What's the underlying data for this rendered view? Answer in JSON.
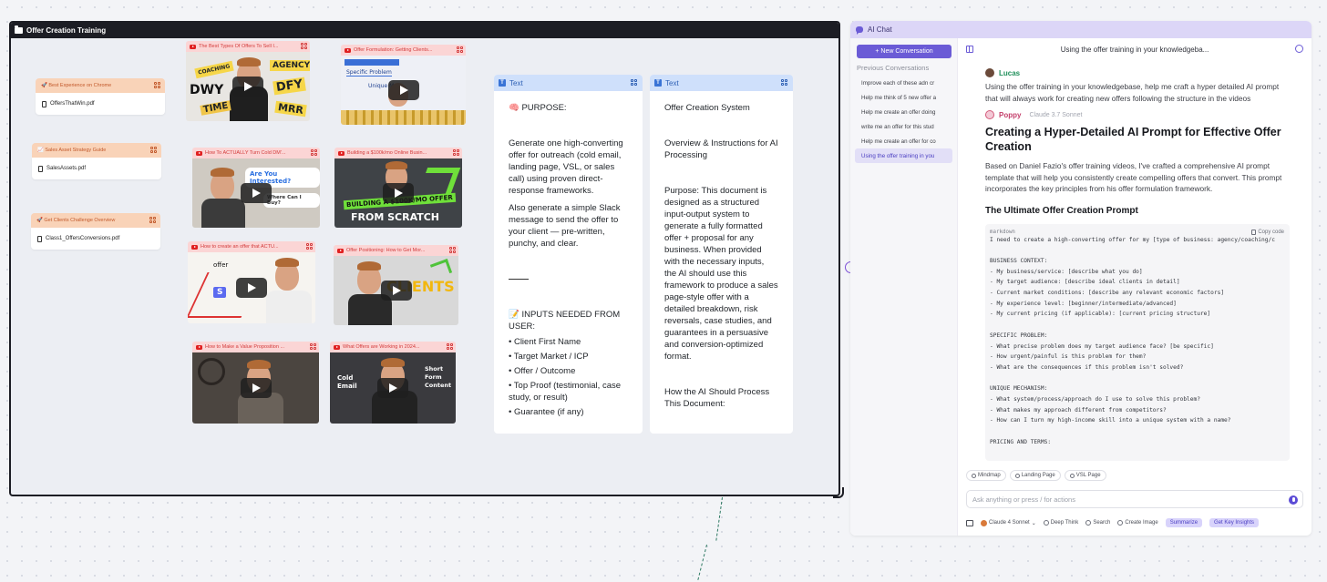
{
  "board": {
    "title": "Offer Creation Training"
  },
  "pdfs": [
    {
      "title": "🚀 Best Experience on Chrome",
      "file": "OffersThatWin.pdf"
    },
    {
      "title": "📈 Sales Asset Strategy Guide",
      "file": "SalesAssets.pdf"
    },
    {
      "title": "🚀 Get Clients Challenge Overview",
      "file": "Class1_OffersConversions.pdf"
    }
  ],
  "videos": [
    {
      "title": "The Best Types Of Offers To Sell I...",
      "thumb_words": [
        "COACHING",
        "AGENCY",
        "DWY",
        "DFY",
        "TIME",
        "MRR"
      ]
    },
    {
      "title": "Offer Formulation: Getting Clients...",
      "thumb_words": [
        "Specific Problem",
        "Unique M..."
      ]
    },
    {
      "title": "How To ACTUALLY Turn Cold DM'...",
      "thumb_words": [
        "Are You Interested?",
        "Where Can I Buy?"
      ]
    },
    {
      "title": "Building a $100k/mo Online Busin...",
      "thumb_words": [
        "BUILDING A $100K/MO OFFER",
        "FROM SCRATCH"
      ]
    },
    {
      "title": "How to create an offer that ACTU...",
      "thumb_words": [
        "offer",
        "S"
      ]
    },
    {
      "title": "Offer Positioning: How to Get Mor...",
      "thumb_words": [
        "CLIENTS"
      ]
    },
    {
      "title": "How to Make a Value Proposition ...",
      "thumb_words": []
    },
    {
      "title": "What Offers are Working in 2024...",
      "thumb_words": [
        "Cold Email",
        "Short Form Content"
      ]
    }
  ],
  "text_cards": [
    {
      "label": "Text",
      "purpose_heading": "🧠 PURPOSE:",
      "para1": "Generate one high-converting offer for outreach (cold email, landing page, VSL, or sales call) using proven direct-response frameworks.",
      "para2": "Also generate a simple Slack message to send the offer to your client — pre-written, punchy, and clear.",
      "inputs_heading": "📝 INPUTS NEEDED FROM USER:",
      "bullets": [
        "• Client First Name",
        "• Target Market / ICP",
        "• Offer / Outcome",
        "• Top Proof (testimonial, case study, or result)",
        "• Guarantee (if any)"
      ]
    },
    {
      "label": "Text",
      "line1": "Offer Creation System",
      "line2": "Overview & Instructions for AI Processing",
      "para": "Purpose: This document is designed as a structured input-output system to generate a fully formatted offer + proposal for any business. When provided with the necessary inputs, the AI should use this framework to produce a sales page-style offer with a detailed breakdown, risk reversals, case studies, and guarantees in a persuasive and conversion-optimized format.",
      "line3": "How the AI Should Process This Document:"
    }
  ],
  "chat": {
    "title": "AI Chat",
    "new_conversation": "+ New Conversation",
    "previous_label": "Previous Conversations",
    "conversations": [
      "Improve each of these adn cr",
      "Help me think of 5 new offer a",
      "Help me create an offer doing",
      "write me an offer for this stud",
      "Help me create an offer for co",
      "Using the offer training in you"
    ],
    "active_conversation": "Using the offer training in your knowledgeba...",
    "user_name": "Lucas",
    "user_message": "Using the offer training in your knowledgebase, help me craft a hyper detailed AI prompt that will always work for creating new offers following the structure in the videos",
    "bot_name": "Poppy",
    "bot_model": "Claude 3.7 Sonnet",
    "response_title": "Creating a Hyper-Detailed AI Prompt for Effective Offer Creation",
    "response_body": "Based on Daniel Fazio's offer training videos, I've crafted a comprehensive AI prompt template that will help you consistently create compelling offers that convert. This prompt incorporates the key principles from his offer formulation framework.",
    "response_h2": "The Ultimate Offer Creation Prompt",
    "code_lang": "markdown",
    "copy_label": "Copy code",
    "code_lines": [
      "I need to create a high-converting offer for my [type of business: agency/coaching/c",
      "",
      "BUSINESS CONTEXT:",
      "- My business/service: [describe what you do]",
      "- My target audience: [describe ideal clients in detail]",
      "- Current market conditions: [describe any relevant economic factors]",
      "- My experience level: [beginner/intermediate/advanced]",
      "- My current pricing (if applicable): [current pricing structure]",
      "",
      "SPECIFIC PROBLEM:",
      "- What precise problem does my target audience face? [be specific]",
      "- How urgent/painful is this problem for them?",
      "- What are the consequences if this problem isn't solved?",
      "",
      "UNIQUE MECHANISM:",
      "- What system/process/approach do I use to solve this problem?",
      "- What makes my approach different from competitors?",
      "- How can I turn my high-income skill into a unique system with a name?",
      "",
      "PRICING AND TERMS:"
    ],
    "action_pills": [
      "Mindmap",
      "Landing Page",
      "VSL Page"
    ],
    "input_placeholder": "Ask anything or press / for actions",
    "toolbar": {
      "model": "Claude 4 Sonnet",
      "deep_think": "Deep Think",
      "search": "Search",
      "create_image": "Create Image",
      "summarize": "Summarize",
      "insights": "Get Key Insights"
    }
  }
}
